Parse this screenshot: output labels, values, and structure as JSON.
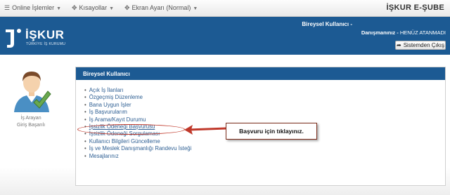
{
  "topbar": {
    "menus": [
      {
        "icon": "list-icon",
        "label": "Online İşlemler"
      },
      {
        "icon": "arrows-icon",
        "label": "Kısayollar"
      },
      {
        "icon": "arrows-icon",
        "label": "Ekran Ayarı (Normal)"
      }
    ],
    "brand": "İŞKUR E-ŞUBE"
  },
  "header": {
    "logo_text": "İŞKUR",
    "logo_sub": "TÜRKİYE İŞ KURUMU",
    "user_line1": "Bireysel Kullanıcı -",
    "user_line2_label": "Danışmanınız - ",
    "user_line2_value": "HENÜZ ATANMADI",
    "logout_label": "Sistemden Çıkış"
  },
  "sidebar": {
    "caption_line1": "İş Arayan",
    "caption_line2": "Giriş Başarılı"
  },
  "panel": {
    "title": "Bireysel Kullanıcı",
    "links": [
      "Açık İş İlanları",
      "Özgeçmiş Düzenleme",
      "Bana Uygun İşler",
      "İş Başvurularım",
      "İş Arama/Kayıt Durumu",
      "İşsizlik Ödeneği Başvurusu",
      "İşsizlik Ödeneği Sorgulaması",
      "Kullanıcı Bilgileri Güncelleme",
      "İş ve Meslek Danışmanlığı Randevu İsteği",
      "Mesajlarınız"
    ]
  },
  "callout": {
    "text": "Başvuru için tıklayınız."
  },
  "colors": {
    "header_blue": "#1c5a93",
    "link_blue": "#2e5f93",
    "highlight_red": "#c0392b",
    "check_green": "#6aa84f"
  }
}
